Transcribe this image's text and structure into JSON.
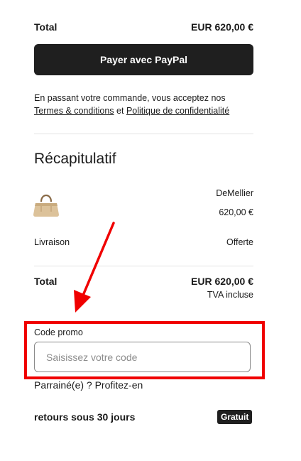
{
  "summary_top": {
    "total_label": "Total",
    "total_value": "EUR 620,00 €"
  },
  "paypal_button": {
    "label": "Payer avec PayPal"
  },
  "terms": {
    "prefix": "En passant votre commande, vous acceptez nos",
    "terms_link": "Termes & conditions",
    "connector": "et",
    "privacy_link": "Politique de confidentialité"
  },
  "recap": {
    "title": "Récapitulatif",
    "product": {
      "brand": "DeMellier",
      "price": "620,00 €",
      "image_icon": "tan-handbag"
    },
    "shipping": {
      "label": "Livraison",
      "value": "Offerte"
    },
    "total": {
      "label": "Total",
      "value": "EUR 620,00 €",
      "tax_note": "TVA incluse"
    }
  },
  "promo": {
    "label": "Code promo",
    "placeholder": "Saisissez votre code",
    "value": "",
    "highlight_color": "#f00000"
  },
  "referral": {
    "text": "Parrainé(e) ? Profitez-en"
  },
  "returns": {
    "label": "retours sous 30 jours",
    "badge": "Gratuit"
  },
  "annotation": {
    "arrow_color": "#f00000"
  }
}
